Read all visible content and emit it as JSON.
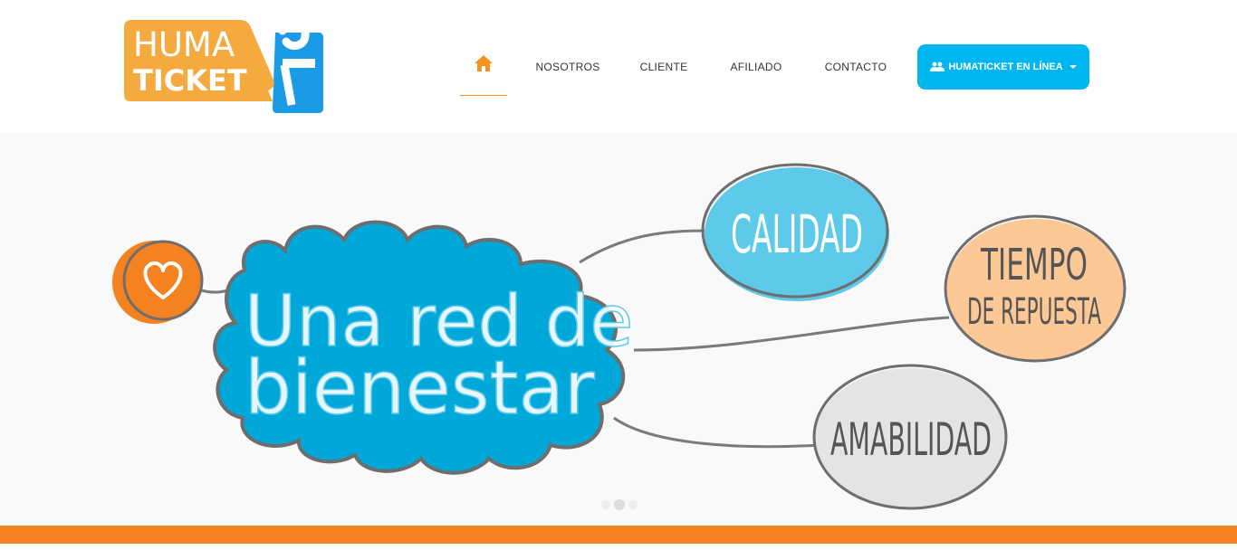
{
  "header": {
    "logo": {
      "line1": "HUMA",
      "line2": "TICKET"
    },
    "nav": {
      "home_icon": "home-icon",
      "items": [
        {
          "label": "NOSOTROS"
        },
        {
          "label": "CLIENTE"
        },
        {
          "label": "AFILIADO"
        },
        {
          "label": "CONTACTO"
        }
      ]
    },
    "online_button": {
      "icon": "users-icon",
      "label": "HUMATICKET EN LÍNEA"
    }
  },
  "hero": {
    "heart_icon": "heart-icon",
    "main_line1": "Una red de",
    "main_line2": "bienestar",
    "bubbles": [
      {
        "label": "CALIDAD"
      },
      {
        "label_line1": "TIEMPO",
        "label_line2": "DE REPUESTA"
      },
      {
        "label": "AMABILIDAD"
      }
    ],
    "carousel": {
      "count": 3,
      "active": 2
    }
  },
  "colors": {
    "accent_orange": "#f39322",
    "accent_blue": "#00b6f1",
    "cloud_blue": "#00a7d9",
    "bubble_calidad": "#5ccae8",
    "bubble_tiempo": "#fcc896",
    "bubble_amabilidad": "#e4e4e4",
    "footer_bar": "#f58220"
  }
}
